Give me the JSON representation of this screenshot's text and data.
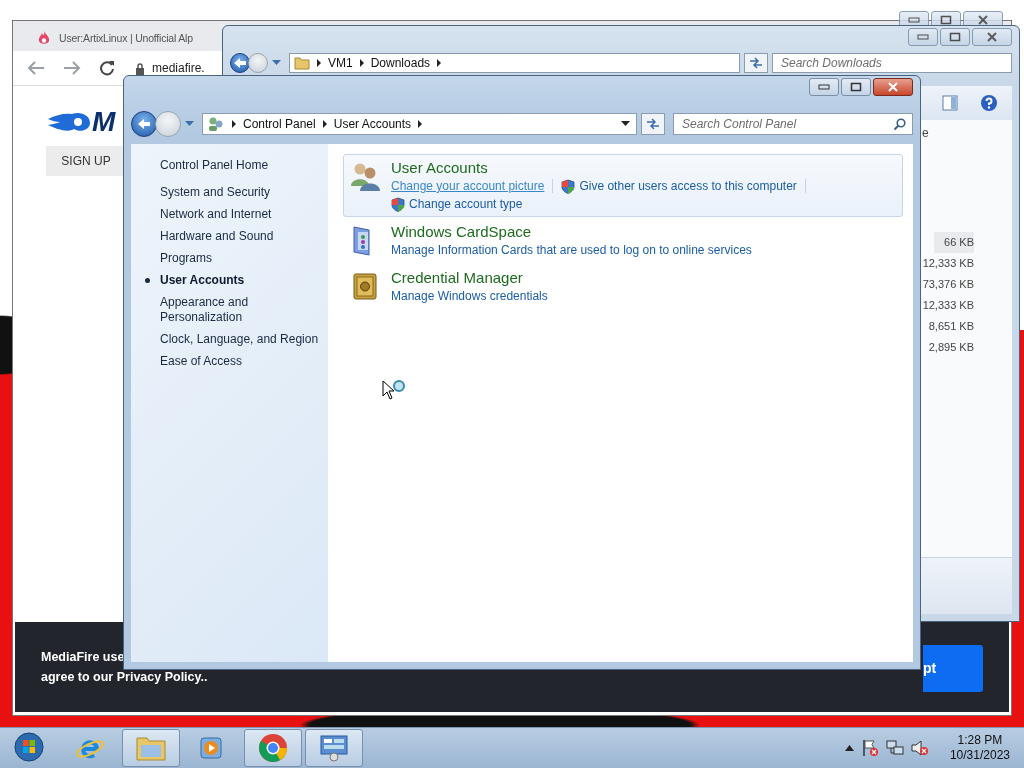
{
  "browser_window": {
    "tab_title": "User:ArtixLinux | Unofficial Alp",
    "address": "mediafire.",
    "logo_text": "M",
    "sign_up": "SIGN UP",
    "cookie_banner": {
      "lines": [
        "MediaFire use",
        "agree to our Privacy Policy.."
      ],
      "button": "pt"
    }
  },
  "explorer_window": {
    "breadcrumb": [
      "VM1",
      "Downloads"
    ],
    "search": {
      "placeholder": "Search Downloads"
    },
    "column_header": "e",
    "sizes": [
      "66 KB",
      "12,333 KB",
      "73,376 KB",
      "12,333 KB",
      "8,651 KB",
      "2,895 KB"
    ]
  },
  "control_panel": {
    "breadcrumb": [
      "Control Panel",
      "User Accounts"
    ],
    "search": {
      "placeholder": "Search Control Panel"
    },
    "sidebar": {
      "home": "Control Panel Home",
      "items": [
        {
          "label": "System and Security",
          "selected": false
        },
        {
          "label": "Network and Internet",
          "selected": false
        },
        {
          "label": "Hardware and Sound",
          "selected": false
        },
        {
          "label": "Programs",
          "selected": false
        },
        {
          "label": "User Accounts",
          "selected": true
        },
        {
          "label": "Appearance and Personalization",
          "selected": false
        },
        {
          "label": "Clock, Language, and Region",
          "selected": false
        },
        {
          "label": "Ease of Access",
          "selected": false
        }
      ]
    },
    "categories": [
      {
        "kind": "users",
        "title": "User Accounts",
        "highlighted": true,
        "links": [
          {
            "label": "Change your account picture",
            "shield": false,
            "hovered": true
          },
          {
            "label": "Give other users access to this computer",
            "shield": true,
            "hovered": false
          },
          {
            "label": "Change account type",
            "shield": true,
            "hovered": false
          }
        ]
      },
      {
        "kind": "cardspace",
        "title": "Windows CardSpace",
        "highlighted": false,
        "links": [
          {
            "label": "Manage Information Cards that are used to log on to online services",
            "shield": false,
            "hovered": false
          }
        ]
      },
      {
        "kind": "vault",
        "title": "Credential Manager",
        "highlighted": false,
        "links": [
          {
            "label": "Manage Windows credentials",
            "shield": false,
            "hovered": false
          }
        ]
      }
    ]
  },
  "taskbar": {
    "apps": [
      {
        "kind": "ie",
        "running": false
      },
      {
        "kind": "folder",
        "running": true
      },
      {
        "kind": "media",
        "running": false
      },
      {
        "kind": "chrome",
        "running": true
      },
      {
        "kind": "control",
        "running": true
      }
    ],
    "time": "1:28 PM",
    "date": "10/31/2023"
  }
}
